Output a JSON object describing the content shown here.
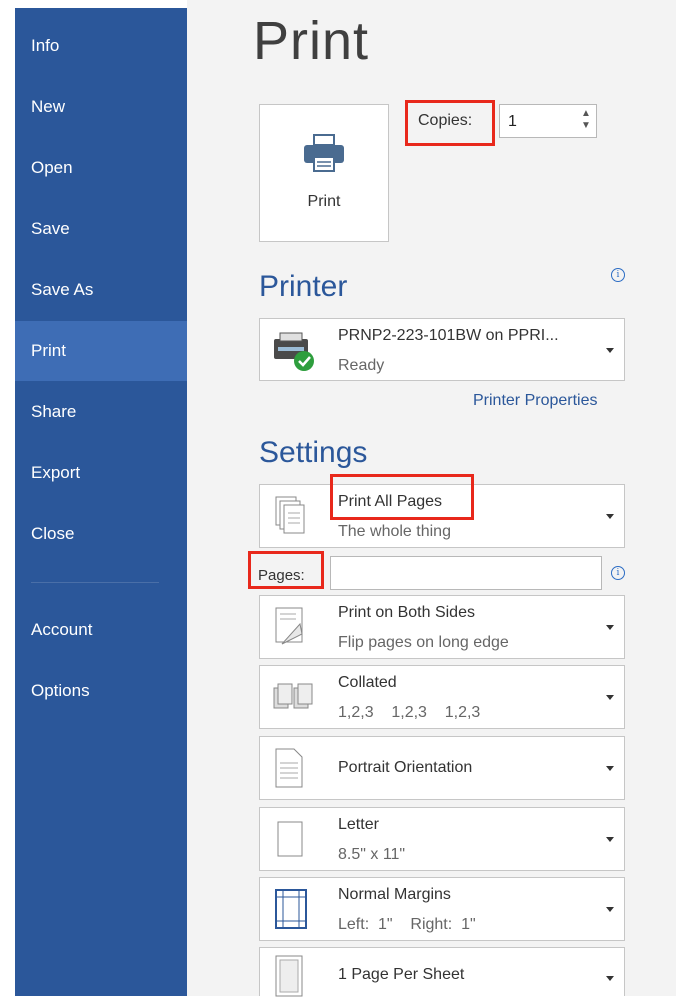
{
  "sidebar": {
    "items": [
      {
        "label": "Info"
      },
      {
        "label": "New"
      },
      {
        "label": "Open"
      },
      {
        "label": "Save"
      },
      {
        "label": "Save As"
      },
      {
        "label": "Print",
        "selected": true
      },
      {
        "label": "Share"
      },
      {
        "label": "Export"
      },
      {
        "label": "Close"
      },
      {
        "label": "Account"
      },
      {
        "label": "Options"
      }
    ]
  },
  "page": {
    "title": "Print"
  },
  "print_button": {
    "label": "Print",
    "icon": "printer-icon"
  },
  "copies": {
    "label": "Copies:",
    "value": "1"
  },
  "printer": {
    "section_title": "Printer",
    "name": "PRNP2-223-101BW on PPRI...",
    "status": "Ready",
    "properties_link": "Printer Properties"
  },
  "settings": {
    "section_title": "Settings",
    "range": {
      "title": "Print All Pages",
      "subtitle": "The whole thing"
    },
    "pages_label": "Pages:",
    "pages_value": "",
    "sides": {
      "title": "Print on Both Sides",
      "subtitle": "Flip pages on long edge"
    },
    "collation": {
      "title": "Collated",
      "subtitle": "1,2,3    1,2,3    1,2,3"
    },
    "orientation": {
      "title": "Portrait Orientation"
    },
    "paper": {
      "title": "Letter",
      "subtitle": "8.5\" x 11\""
    },
    "margins": {
      "title": "Normal Margins",
      "subtitle": "Left:  1\"    Right:  1\""
    },
    "per_sheet": {
      "title": "1 Page Per Sheet"
    }
  },
  "colors": {
    "sidebar": "#2b579a",
    "selected": "#3e6db5",
    "highlight": "#e8281b",
    "accent": "#2b579a"
  }
}
